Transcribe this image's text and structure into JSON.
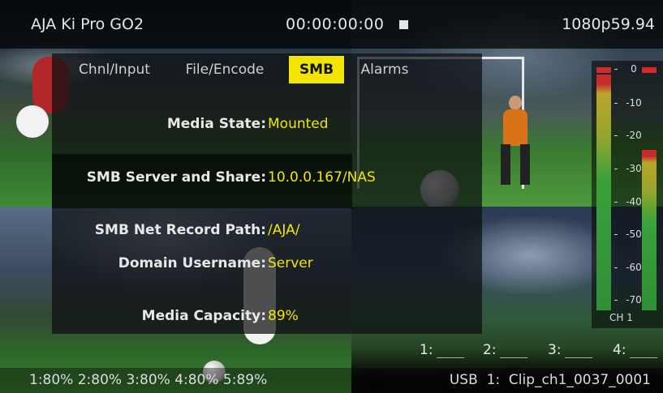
{
  "header": {
    "device_name": "AJA Ki Pro GO2",
    "timecode": "00:00:00:00",
    "transport_state_icon": "stop-icon",
    "video_format": "1080p59.94"
  },
  "tabs": [
    {
      "label": "Chnl/Input",
      "active": false
    },
    {
      "label": "File/Encode",
      "active": false
    },
    {
      "label": "SMB",
      "active": true
    },
    {
      "label": "Alarms",
      "active": false
    }
  ],
  "settings": {
    "media_state": {
      "label": "Media State:",
      "value": "Mounted"
    },
    "server_share": {
      "label": "SMB Server and Share:",
      "value": "10.0.0.167/NAS"
    },
    "record_path": {
      "label": "SMB Net Record Path:",
      "value": "/AJA/"
    },
    "domain_user": {
      "label": "Domain Username:",
      "value": "Server"
    },
    "capacity": {
      "label": "Media Capacity:",
      "value": "89%"
    }
  },
  "audio_meter": {
    "scale": [
      "0",
      "-10",
      "-20",
      "-30",
      "-40",
      "-50",
      "-60",
      "-70"
    ],
    "channel_label": "CH 1",
    "levels": [
      0.97,
      0.66
    ]
  },
  "inputs": [
    {
      "label": "1:"
    },
    {
      "label": "2:"
    },
    {
      "label": "3:"
    },
    {
      "label": "4:"
    }
  ],
  "footer": {
    "media_levels": "1:80% 2:80% 3:80% 4:80% 5:89%",
    "recording_target": "USB  1:  Clip_ch1_0037_0001"
  },
  "colors": {
    "accent": "#f2e600",
    "meter_green": "#3aa13b",
    "meter_red": "#d02a2a"
  }
}
